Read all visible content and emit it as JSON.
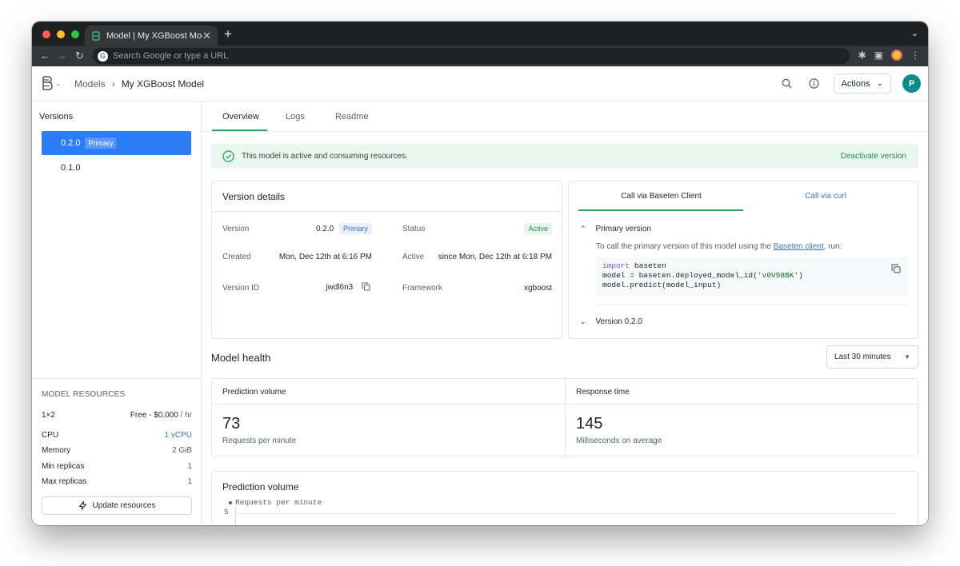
{
  "browser": {
    "tab_title": "Model | My XGBoost Model",
    "omnibox_placeholder": "Search Google or type a URL"
  },
  "header": {
    "breadcrumb_models": "Models",
    "breadcrumb_current": "My XGBoost Model",
    "actions_label": "Actions",
    "avatar_initial": "P"
  },
  "sidebar": {
    "title": "Versions",
    "versions": [
      {
        "label": "0.2.0",
        "badge": "Primary"
      },
      {
        "label": "0.1.0"
      }
    ],
    "resources": {
      "title": "MODEL RESOURCES",
      "instance": "1×2",
      "price_main": "Free - $0.000",
      "price_unit": "/ hr",
      "rows": [
        {
          "label": "CPU",
          "value": "1 vCPU"
        },
        {
          "label": "Memory",
          "value": "2 GiB"
        },
        {
          "label": "Min replicas",
          "value": "1"
        },
        {
          "label": "Max replicas",
          "value": "1"
        }
      ],
      "update_label": "Update resources"
    }
  },
  "main": {
    "tabs": [
      "Overview",
      "Logs",
      "Readme"
    ],
    "banner": {
      "message": "This model is active and consuming resources.",
      "action": "Deactivate version"
    },
    "version_details": {
      "title": "Version details",
      "version_label": "Version",
      "version_value": "0.2.0",
      "version_badge": "Primary",
      "status_label": "Status",
      "status_value": "Active",
      "created_label": "Created",
      "created_value": "Mon, Dec 12th at 6:16 PM",
      "active_label": "Active",
      "active_value": "since Mon, Dec 12th at 6:18 PM",
      "version_id_label": "Version ID",
      "version_id_value": "jwdl6n3",
      "framework_label": "Framework",
      "framework_value": "xgboost"
    },
    "call": {
      "tab_client": "Call via Baseten Client",
      "tab_curl": "Call via curl",
      "primary_header": "Primary version",
      "instruction_prefix": "To call the primary version of this model using the",
      "instruction_link": "Baseten client",
      "instruction_suffix": ", run:",
      "code_line1_kw": "import",
      "code_line1_rest": " baseten",
      "code_line2_a": "model = baseten.deployed_model_id(",
      "code_line2_str": "'v0V98BK'",
      "code_line2_b": ")",
      "code_line3": "model.predict(model_input)",
      "version_header": "Version 0.2.0"
    },
    "health": {
      "title": "Model health",
      "range": "Last 30 minutes",
      "prediction_title": "Prediction volume",
      "prediction_value": "73",
      "prediction_sub": "Requests per minute",
      "response_title": "Response time",
      "response_value": "145",
      "response_sub": "Milliseconds on average"
    },
    "chart_card": {
      "title": "Prediction volume",
      "legend": "Requests per minute",
      "y_tick": "5"
    }
  },
  "colors": {
    "accent_blue": "#2b7cf6",
    "success_green": "#2e9e5b",
    "avatar_teal": "#0e8a8a"
  }
}
